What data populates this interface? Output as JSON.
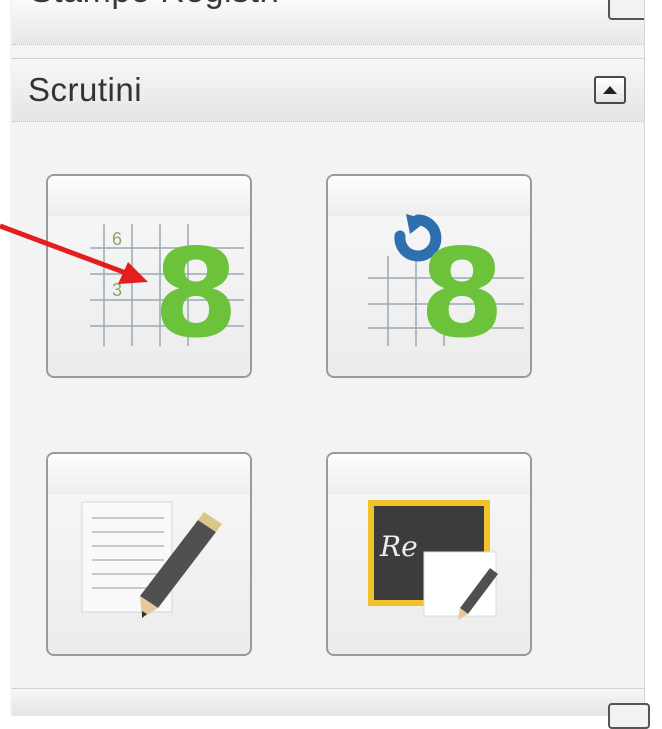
{
  "panel": {
    "previous_section_title": "Stampe Registri",
    "section_title": "Scrutini",
    "collapse_icon": "triangle-up-icon"
  },
  "tiles": [
    {
      "icon": "grade-eight-grid-icon",
      "grid_numbers": [
        "6",
        "3"
      ],
      "big_digit": "8"
    },
    {
      "icon": "grade-eight-refresh-icon",
      "big_digit": "8"
    },
    {
      "icon": "notes-pencil-icon"
    },
    {
      "icon": "blackboard-pencil-icon",
      "board_text": "Re"
    }
  ],
  "colors": {
    "digit_green": "#6cc23a",
    "annotation_red": "#e31e1e",
    "refresh_blue": "#2f6fb0",
    "board_dark": "#3c3c3c",
    "board_frame": "#f2c22b"
  }
}
